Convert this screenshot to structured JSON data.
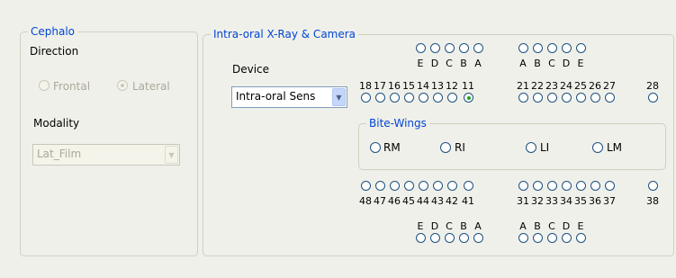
{
  "cephalo": {
    "title": "Cephalo",
    "direction_label": "Direction",
    "frontal_label": "Frontal",
    "lateral_label": "Lateral",
    "modality_label": "Modality",
    "modality_value": "Lat_Film"
  },
  "intraoral": {
    "title": "Intra-oral X-Ray & Camera",
    "device_label": "Device",
    "device_value": "Intra-oral Sens",
    "upper_letters_left": [
      "E",
      "D",
      "C",
      "B",
      "A"
    ],
    "upper_letters_right": [
      "A",
      "B",
      "C",
      "D",
      "E"
    ],
    "upper_numbers_left": [
      "18",
      "17",
      "16",
      "15",
      "14",
      "13",
      "12",
      "11"
    ],
    "upper_numbers_right": [
      "21",
      "22",
      "23",
      "24",
      "25",
      "26",
      "27",
      "28"
    ],
    "lower_numbers_left": [
      "48",
      "47",
      "46",
      "45",
      "44",
      "43",
      "42",
      "41"
    ],
    "lower_numbers_right": [
      "31",
      "32",
      "33",
      "34",
      "35",
      "36",
      "37",
      "38"
    ],
    "lower_letters_left": [
      "E",
      "D",
      "C",
      "B",
      "A"
    ],
    "lower_letters_right": [
      "A",
      "B",
      "C",
      "D",
      "E"
    ],
    "selected_tooth": "11"
  },
  "bitewings": {
    "title": "Bite-Wings",
    "options": [
      "RM",
      "RI",
      "LI",
      "LM"
    ]
  }
}
